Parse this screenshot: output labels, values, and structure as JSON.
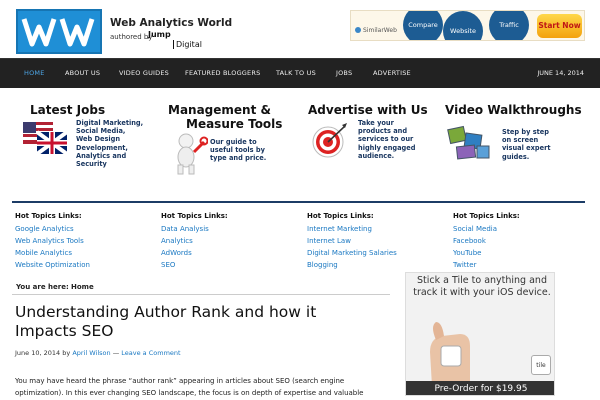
{
  "header": {
    "site_name": "Web Analytics World",
    "authored_by": "authored by",
    "jump": "Jump",
    "digital": "Digital",
    "logo_text": "WW"
  },
  "banner": {
    "brand": "SimilarWeb",
    "compare": "Compare",
    "website": "Website",
    "traffic": "Traffic",
    "start": "Start Now"
  },
  "nav": {
    "items": [
      "HOME",
      "ABOUT US",
      "VIDEO GUIDES",
      "FEATURED BLOGGERS",
      "TALK TO US",
      "JOBS",
      "ADVERTISE"
    ],
    "date": "JUNE 14, 2014"
  },
  "promos": [
    {
      "title": "Latest Jobs",
      "desc": [
        "Digital Marketing,",
        "Social Media,",
        "Web Design",
        "Development,",
        "Analytics and",
        "Security"
      ]
    },
    {
      "title_line1": "Management &",
      "title_line2": "Measure Tools",
      "desc": [
        "Our guide to",
        "useful tools by",
        "type and price."
      ]
    },
    {
      "title": "Advertise with Us",
      "desc": [
        "Take your",
        "products and",
        "services to our",
        "highly engaged",
        "audience."
      ]
    },
    {
      "title": "Video Walkthroughs",
      "desc": [
        "Step by step",
        "on screen",
        "visual expert",
        "guides."
      ]
    }
  ],
  "hot_topics": [
    {
      "heading": "Hot Topics Links:",
      "links": [
        "Google Analytics",
        "Web Analytics Tools",
        "Mobile Analytics",
        "Website Optimization"
      ]
    },
    {
      "heading": "Hot Topics Links:",
      "links": [
        "Data Analysis",
        "Analytics",
        "AdWords",
        "SEO"
      ]
    },
    {
      "heading": "Hot Topics Links:",
      "links": [
        "Internet Marketing",
        "Internet Law",
        "Digital Marketing Salaries",
        "Blogging"
      ]
    },
    {
      "heading": "Hot Topics Links:",
      "links": [
        "Social Media",
        "Facebook",
        "YouTube",
        "Twitter"
      ]
    }
  ],
  "breadcrumb": {
    "prefix": "You are here:",
    "current": "Home"
  },
  "post": {
    "title": "Understanding Author Rank and how it Impacts SEO",
    "date": "June 10, 2014",
    "by": "by",
    "author": "April Wilson",
    "sep": "—",
    "comment": "Leave a Comment",
    "excerpt": "You may have heard the phrase “author rank” appearing in articles about SEO (search engine optimization). In this ever changing SEO landscape, the focus is on depth of expertise and valuable content. The importance of"
  },
  "ad": {
    "headline": "Stick a Tile to anything and track it with your iOS device.",
    "tile": "tile",
    "cta": "Pre-Order for $19.95"
  },
  "colors": {
    "nav_bg": "#222222",
    "link": "#1a78c2",
    "accent": "#1f8fd6",
    "divider": "#1c3c66"
  }
}
